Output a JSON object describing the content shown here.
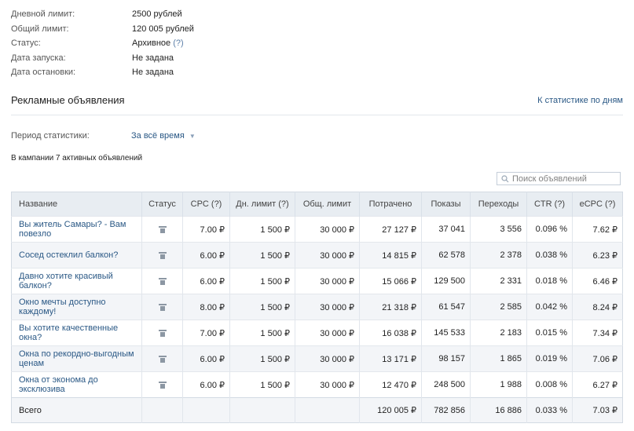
{
  "info": {
    "rows": [
      {
        "label": "Дневной лимит:",
        "value": "2500 рублей"
      },
      {
        "label": "Общий лимит:",
        "value": "120 005 рублей"
      },
      {
        "label": "Статус:",
        "value": "Архивное"
      },
      {
        "label": "Дата запуска:",
        "value": "Не задана"
      },
      {
        "label": "Дата остановки:",
        "value": "Не задана"
      }
    ],
    "status_help": "(?)"
  },
  "section": {
    "title": "Рекламные объявления",
    "link": "К статистике по дням"
  },
  "period": {
    "label": "Период статистики:",
    "value": "За всё время",
    "arrow_icon": "caret-down-icon"
  },
  "ads_count_text": "В кампании 7 активных объявлений",
  "search": {
    "placeholder": "Поиск объявлений",
    "icon": "search-icon"
  },
  "table": {
    "headers": [
      "Название",
      "Статус",
      "CPC (?)",
      "Дн. лимит (?)",
      "Общ. лимит",
      "Потрачено",
      "Показы",
      "Переходы",
      "CTR (?)",
      "eCPC (?)"
    ],
    "rows": [
      {
        "name": "Вы житель Самары? - Вам повезло",
        "cpc": "7.00 ₽",
        "day_limit": "1 500 ₽",
        "total_limit": "30 000 ₽",
        "spent": "27 127 ₽",
        "impressions": "37 041",
        "clicks": "3 556",
        "ctr": "0.096 %",
        "ecpc": "7.62 ₽"
      },
      {
        "name": "Сосед остеклил балкон?",
        "cpc": "6.00 ₽",
        "day_limit": "1 500 ₽",
        "total_limit": "30 000 ₽",
        "spent": "14 815 ₽",
        "impressions": "62 578",
        "clicks": "2 378",
        "ctr": "0.038 %",
        "ecpc": "6.23 ₽"
      },
      {
        "name": "Давно хотите красивый балкон?",
        "cpc": "6.00 ₽",
        "day_limit": "1 500 ₽",
        "total_limit": "30 000 ₽",
        "spent": "15 066 ₽",
        "impressions": "129 500",
        "clicks": "2 331",
        "ctr": "0.018 %",
        "ecpc": "6.46 ₽"
      },
      {
        "name": "Окно мечты доступно каждому!",
        "cpc": "8.00 ₽",
        "day_limit": "1 500 ₽",
        "total_limit": "30 000 ₽",
        "spent": "21 318 ₽",
        "impressions": "61 547",
        "clicks": "2 585",
        "ctr": "0.042 %",
        "ecpc": "8.24 ₽"
      },
      {
        "name": "Вы хотите качественные окна?",
        "cpc": "7.00 ₽",
        "day_limit": "1 500 ₽",
        "total_limit": "30 000 ₽",
        "spent": "16 038 ₽",
        "impressions": "145 533",
        "clicks": "2 183",
        "ctr": "0.015 %",
        "ecpc": "7.34 ₽"
      },
      {
        "name": "Окна по рекордно-выгодным ценам",
        "cpc": "6.00 ₽",
        "day_limit": "1 500 ₽",
        "total_limit": "30 000 ₽",
        "spent": "13 171 ₽",
        "impressions": "98 157",
        "clicks": "1 865",
        "ctr": "0.019 %",
        "ecpc": "7.06 ₽"
      },
      {
        "name": "Окна от эконома до эксклюзива",
        "cpc": "6.00 ₽",
        "day_limit": "1 500 ₽",
        "total_limit": "30 000 ₽",
        "spent": "12 470 ₽",
        "impressions": "248 500",
        "clicks": "1 988",
        "ctr": "0.008 %",
        "ecpc": "6.27 ₽"
      }
    ],
    "total": {
      "label": "Всего",
      "spent": "120 005 ₽",
      "impressions": "782 856",
      "clicks": "16 886",
      "ctr": "0.033 %",
      "ecpc": "7.03 ₽"
    },
    "status_icon": "trash-icon"
  }
}
